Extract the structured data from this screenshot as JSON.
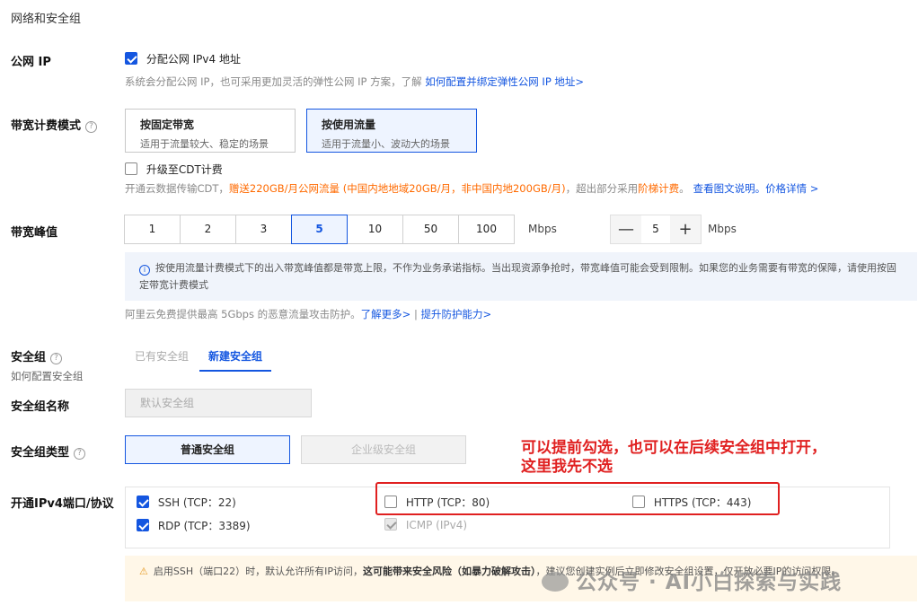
{
  "section_title": "网络和安全组",
  "public_ip": {
    "label": "公网 IP",
    "checkbox_label": "分配公网 IPv4 地址",
    "desc": "系统会分配公网 IP，也可采用更加灵活的弹性公网 IP 方案，了解",
    "link": "如何配置并绑定弹性公网 IP 地址>"
  },
  "billing": {
    "label": "带宽计费模式",
    "help": "?",
    "options": [
      {
        "title": "按固定带宽",
        "desc": "适用于流量较大、稳定的场景"
      },
      {
        "title": "按使用流量",
        "desc": "适用于流量小、波动大的场景"
      }
    ],
    "cdt_label": "升级至CDT计费",
    "cdt_desc_1": "开通云数据传输CDT，",
    "cdt_desc_orange": "赠送220GB/月公网流量 (中国内地地域20GB/月，非中国内地200GB/月)",
    "cdt_desc_2": "，超出部分采用",
    "cdt_desc_orange2": "阶梯计费",
    "cdt_desc_3": "。",
    "cdt_link": "查看图文说明。价格详情 >"
  },
  "bandwidth": {
    "label": "带宽峰值",
    "options": [
      "1",
      "2",
      "3",
      "5",
      "10",
      "50",
      "100"
    ],
    "selected": "5",
    "unit": "Mbps",
    "stepper_minus": "—",
    "stepper_value": "5",
    "stepper_plus": "+",
    "stepper_unit": "Mbps",
    "info_icon": "i",
    "info_text": "按使用流量计费模式下的出入带宽峰值都是带宽上限，不作为业务承诺指标。当出现资源争抢时，带宽峰值可能会受到限制。如果您的业务需要有带宽的保障，请使用按固定带宽计费模式",
    "ddos_text": "阿里云免费提供最高 5Gbps 的恶意流量攻击防护。",
    "ddos_link1": "了解更多>",
    "ddos_sep": "|",
    "ddos_link2": "提升防护能力>"
  },
  "security_group": {
    "label": "安全组",
    "help": "?",
    "sub_link": "如何配置安全组",
    "tabs": [
      "已有安全组",
      "新建安全组"
    ],
    "name_label": "安全组名称",
    "name_placeholder": "默认安全组",
    "type_label": "安全组类型",
    "help2": "?",
    "types": [
      "普通安全组",
      "企业级安全组"
    ]
  },
  "ports": {
    "label": "开通IPv4端口/协议",
    "items": [
      {
        "label": "SSH (TCP：22)",
        "checked": true
      },
      {
        "label": "RDP (TCP：3389)",
        "checked": true
      },
      {
        "label": "HTTP (TCP：80)",
        "checked": false
      },
      {
        "label": "ICMP (IPv4)",
        "checked": true
      },
      {
        "label": "HTTPS (TCP：443)",
        "checked": false
      }
    ]
  },
  "warning": {
    "icon": "⚠",
    "text_1": "启用SSH（端口22）时，默认允许所有IP访问，",
    "text_bold": "这可能带来安全风险（如暴力破解攻击）",
    "text_2": "，建议您创建实例后立即修改安全组设置，仅开放必要IP的访问权限。"
  },
  "annotation": {
    "line1": "可以提前勾选，也可以在后续安全组中打开，",
    "line2": "这里我先不选",
    "color": "#e02020"
  },
  "watermark": {
    "text": "公众号 · AI小白探索与实践"
  },
  "colors": {
    "accent": "#1456e0",
    "orange": "#ff6a00",
    "warn": "#e69a22"
  }
}
